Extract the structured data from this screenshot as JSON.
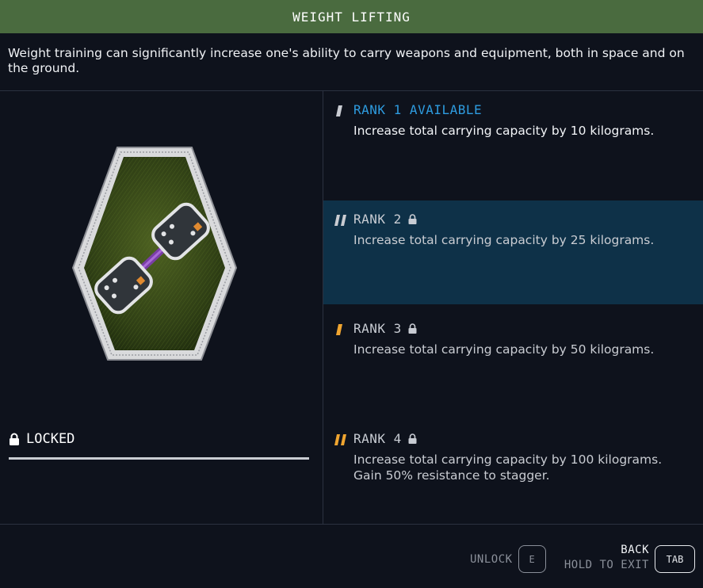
{
  "header": {
    "title": "WEIGHT LIFTING"
  },
  "description": "Weight training can significantly increase one's ability to carry weapons and equipment, both in space and on the ground.",
  "status": {
    "label": "LOCKED",
    "icon": "lock-icon"
  },
  "ranks": [
    {
      "title": "RANK 1 AVAILABLE",
      "desc": "Increase total carrying capacity by 10 kilograms.",
      "mark_color": "#c9ccd2",
      "locked": false
    },
    {
      "title": "RANK 2",
      "desc": "Increase total carrying capacity by 25 kilograms.",
      "mark_color": "#c9ccd2",
      "locked": true
    },
    {
      "title": "RANK 3",
      "desc": "Increase total carrying capacity by 50 kilograms.",
      "mark_color": "#f0a530",
      "locked": true
    },
    {
      "title": "RANK 4",
      "desc": "Increase total carrying capacity by 100 kilograms.",
      "desc2": "Gain 50% resistance to stagger.",
      "mark_color": "#f0a530",
      "locked": true
    }
  ],
  "footer": {
    "unlock_label": "UNLOCK",
    "unlock_key": "E",
    "back_label": "BACK",
    "hold_label": "HOLD TO EXIT",
    "back_key": "TAB"
  },
  "colors": {
    "title_bar": "#4a6b3f",
    "available": "#2e9ce0",
    "selected_bg": "#0e3148",
    "background": "#0e121c"
  }
}
